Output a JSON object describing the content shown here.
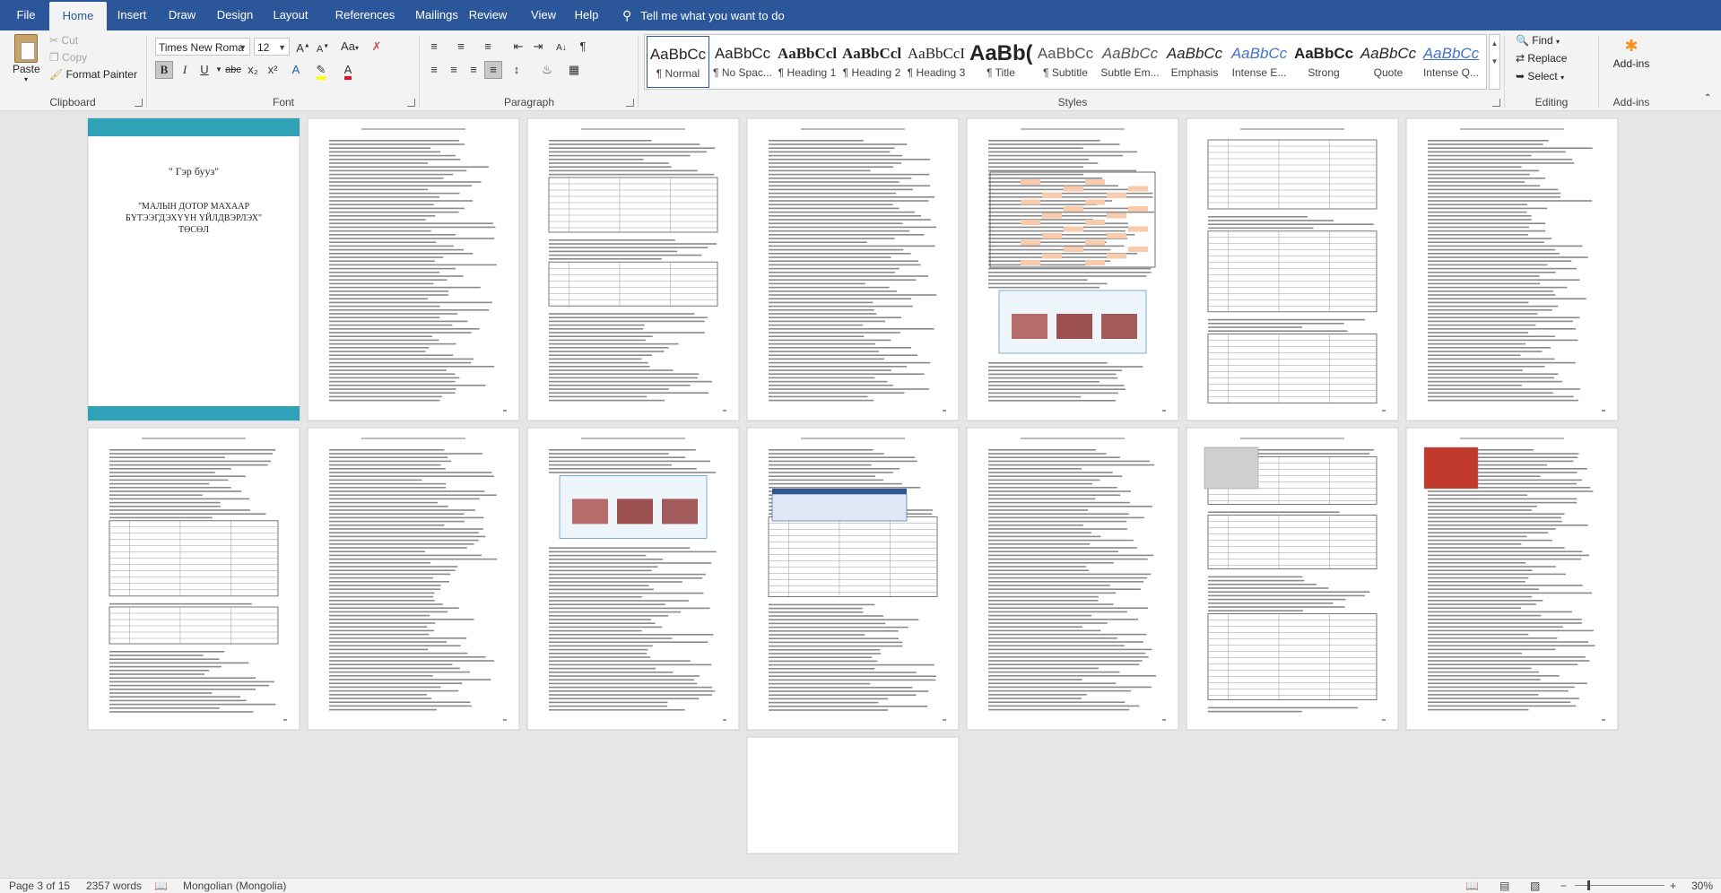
{
  "ribbon_tabs": [
    "File",
    "Home",
    "Insert",
    "Draw",
    "Design",
    "Layout",
    "References",
    "Mailings",
    "Review",
    "View",
    "Help"
  ],
  "tell_me": "Tell me what you want to do",
  "clipboard": {
    "paste": "Paste",
    "cut": "Cut",
    "copy": "Copy",
    "format_painter": "Format Painter",
    "label": "Clipboard"
  },
  "font": {
    "family": "Times New Roma",
    "size": "12",
    "label": "Font",
    "bold": "B",
    "italic": "I",
    "underline": "U",
    "strike": "abc",
    "sub": "x₂",
    "sup": "x²",
    "case": "Aa"
  },
  "paragraph": {
    "label": "Paragraph"
  },
  "styles": {
    "label": "Styles",
    "items": [
      {
        "sample": "AaBbCc",
        "name": "¶ Normal"
      },
      {
        "sample": "AaBbCc",
        "name": "¶ No Spac..."
      },
      {
        "sample": "AaBbCcl",
        "name": "¶ Heading 1"
      },
      {
        "sample": "AaBbCcl",
        "name": "¶ Heading 2"
      },
      {
        "sample": "AaBbCcI",
        "name": "¶ Heading 3"
      },
      {
        "sample": "AaBb(",
        "name": "¶ Title"
      },
      {
        "sample": "AaBbCc",
        "name": "¶ Subtitle"
      },
      {
        "sample": "AaBbCc",
        "name": "Subtle Em..."
      },
      {
        "sample": "AaBbCc",
        "name": "Emphasis"
      },
      {
        "sample": "AaBbCc",
        "name": "Intense E..."
      },
      {
        "sample": "AaBbCc",
        "name": "Strong"
      },
      {
        "sample": "AaBbCc",
        "name": "Quote"
      },
      {
        "sample": "AaBbCc",
        "name": "Intense Q..."
      }
    ]
  },
  "editing": {
    "label": "Editing",
    "find": "Find",
    "replace": "Replace",
    "select": "Select"
  },
  "addins": {
    "label": "Add-ins",
    "button": "Add-ins"
  },
  "document": {
    "cover": {
      "title1": "\" Гэр бууз\"",
      "title2": "\"МАЛЫН ДОТОР МАХААР БҮТЭЭГДЭХҮҮН ҮЙЛДВЭРЛЭХ\" ТӨСӨЛ"
    },
    "running_header": "\"Малын дотор махаар бүтээгдэхүүн үйлдвэрлэх\""
  },
  "statusbar": {
    "page": "Page 3 of 15",
    "words": "2357 words",
    "language": "Mongolian (Mongolia)",
    "zoom": "30%"
  }
}
